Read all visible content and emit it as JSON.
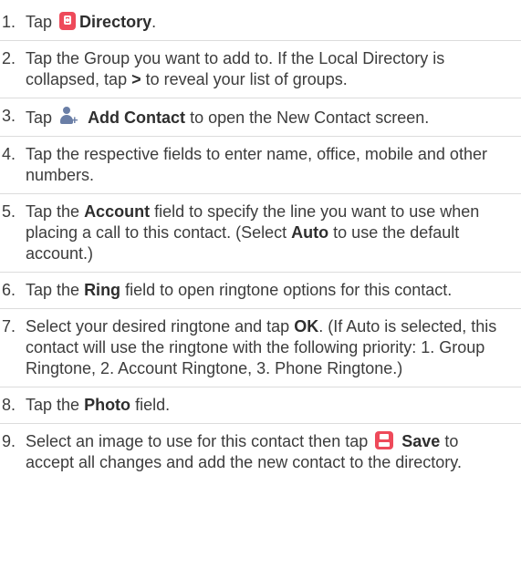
{
  "steps": [
    {
      "num": "1.",
      "a": "Tap",
      "icon": "directory-icon",
      "b": "Directory",
      "c": "."
    },
    {
      "num": "2.",
      "a": "Tap the Group you want to add to. If the Local Directory is collapsed, tap",
      "b": ">",
      "c": "to reveal your list of groups."
    },
    {
      "num": "3.",
      "a": "Tap",
      "icon": "add-contact-icon",
      "b": "Add Contact",
      "c": "to open the New Contact screen."
    },
    {
      "num": "4.",
      "a": "Tap the respective fields to enter name, office, mobile and other numbers."
    },
    {
      "num": "5.",
      "a": "Tap the",
      "b": "Account",
      "c": "field to specify the line you want to use when placing a call to this contact. (Select",
      "d": "Auto",
      "e": "to use the default account.)"
    },
    {
      "num": "6.",
      "a": "Tap the",
      "b": "Ring",
      "c": "field to open ringtone options for this contact."
    },
    {
      "num": "7.",
      "a": "Select your desired ringtone and tap",
      "b": "OK",
      "c": ". (If Auto is selected, this contact will use the ringtone with the following priority: 1. Group Ringtone, 2. Account Ringtone, 3. Phone Ringtone.)"
    },
    {
      "num": "8.",
      "a": "Tap the",
      "b": "Photo",
      "c": "field."
    },
    {
      "num": "9.",
      "a": "Select an image to use for this contact then tap",
      "icon": "save-icon",
      "b": "Save",
      "c": "to accept all changes and add the new contact to the directory."
    }
  ]
}
